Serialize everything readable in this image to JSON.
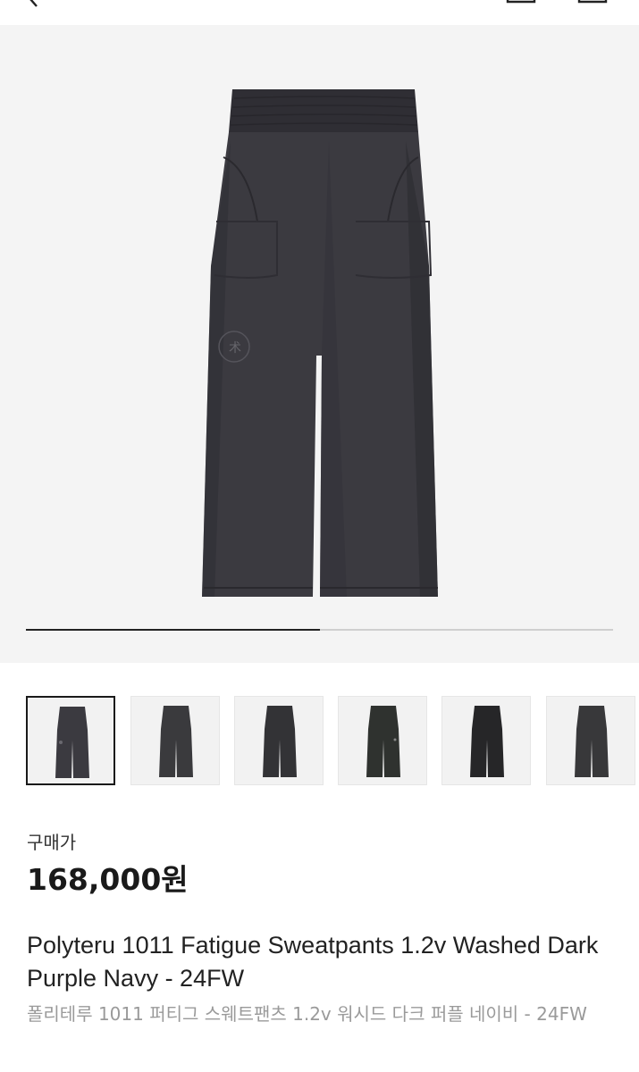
{
  "header": {
    "back_icon": "chevron-left-icon",
    "right_icons": [
      "share-icon",
      "bag-icon"
    ]
  },
  "gallery": {
    "progress": 0.5,
    "colors": {
      "pants": "#3b3a40",
      "pants_shadow": "#2c2b31",
      "background": "#f4f4f4"
    }
  },
  "thumbnails": {
    "count": 6,
    "active_index": 0
  },
  "product": {
    "price_label": "구매가",
    "price": "168,000원",
    "title": "Polyteru 1011 Fatigue Sweatpants 1.2v Washed Dark Purple Navy - 24FW",
    "subtitle": "폴리테루 1011 퍼티그 스웨트팬츠 1.2v 워시드 다크 퍼플 네이비 - 24FW"
  }
}
